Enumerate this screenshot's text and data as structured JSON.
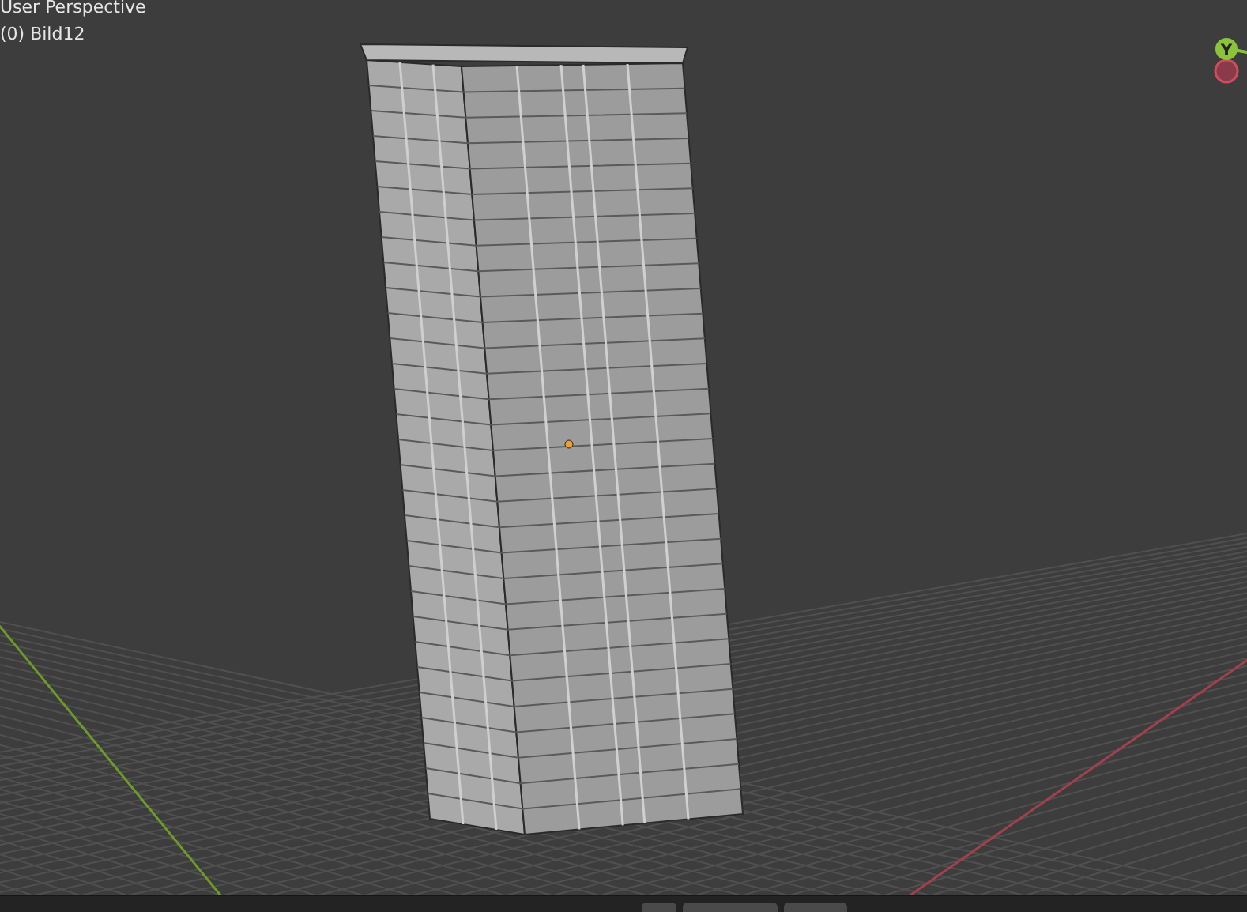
{
  "viewport": {
    "view_name": "User Perspective",
    "object_label": "(0) Bild12"
  },
  "gizmo": {
    "axes": [
      {
        "label": "Y"
      }
    ]
  }
}
